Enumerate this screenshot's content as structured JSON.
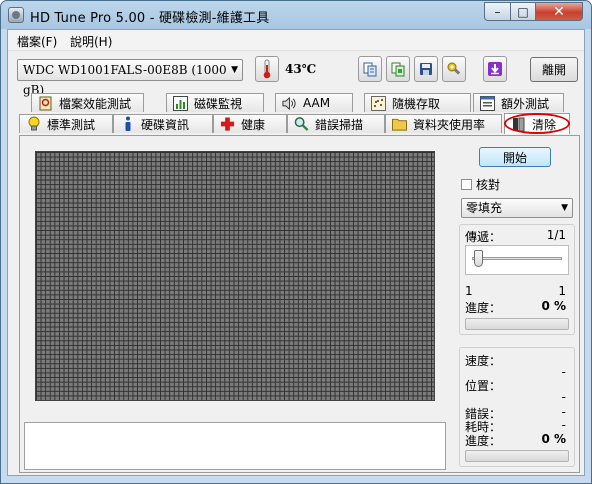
{
  "window": {
    "title": "HD Tune Pro  5.00 - 硬碟檢測-維護工具",
    "minimize": "–",
    "maximize": "□",
    "close": "✕"
  },
  "menu": {
    "file": "檔案(F)",
    "help": "說明(H)"
  },
  "toolbar": {
    "drive": "WDC WD1001FALS-00E8B    (1000 gB)",
    "temperature": "43℃",
    "exit": "離開"
  },
  "tabs_top": [
    {
      "label": "檔案效能測試",
      "icon": "file-benchmark-icon"
    },
    {
      "label": "磁碟監視",
      "icon": "disk-monitor-icon"
    },
    {
      "label": "AAM",
      "icon": "speaker-icon"
    },
    {
      "label": "隨機存取",
      "icon": "random-access-icon"
    },
    {
      "label": "額外測試",
      "icon": "extra-tests-icon"
    }
  ],
  "tabs_bottom": [
    {
      "label": "標準測試",
      "icon": "lightbulb-icon"
    },
    {
      "label": "硬碟資訊",
      "icon": "info-icon"
    },
    {
      "label": "健康",
      "icon": "health-cross-icon"
    },
    {
      "label": "錯誤掃描",
      "icon": "magnifier-icon"
    },
    {
      "label": "資料夾使用率",
      "icon": "folder-icon"
    },
    {
      "label": "清除",
      "icon": "eraser-icon",
      "active": true
    }
  ],
  "erase": {
    "start": "開始",
    "verify": "核對",
    "verify_checked": false,
    "mode": "零填充",
    "pass_label": "傳遞：",
    "pass_value": "1/1",
    "slider_min": "1",
    "slider_max": "1",
    "slider_fraction": 0,
    "progress_label": "進度：",
    "progress_value": "0 %",
    "progress_fraction": 0,
    "speed_label": "速度：",
    "position_label": "位置：",
    "position_value": "-",
    "errors_label": "錯誤：",
    "errors_value": "-",
    "elapsed_label": "耗時：",
    "elapsed_value": "-",
    "progress2_label": "進度：",
    "progress2_value": "0 %",
    "progress2_fraction": 0,
    "speed_value": "-"
  },
  "colors": {
    "accent_ring": "#e00000",
    "grid_block": "#7b7b7b",
    "progress_fill": "#37c437"
  }
}
